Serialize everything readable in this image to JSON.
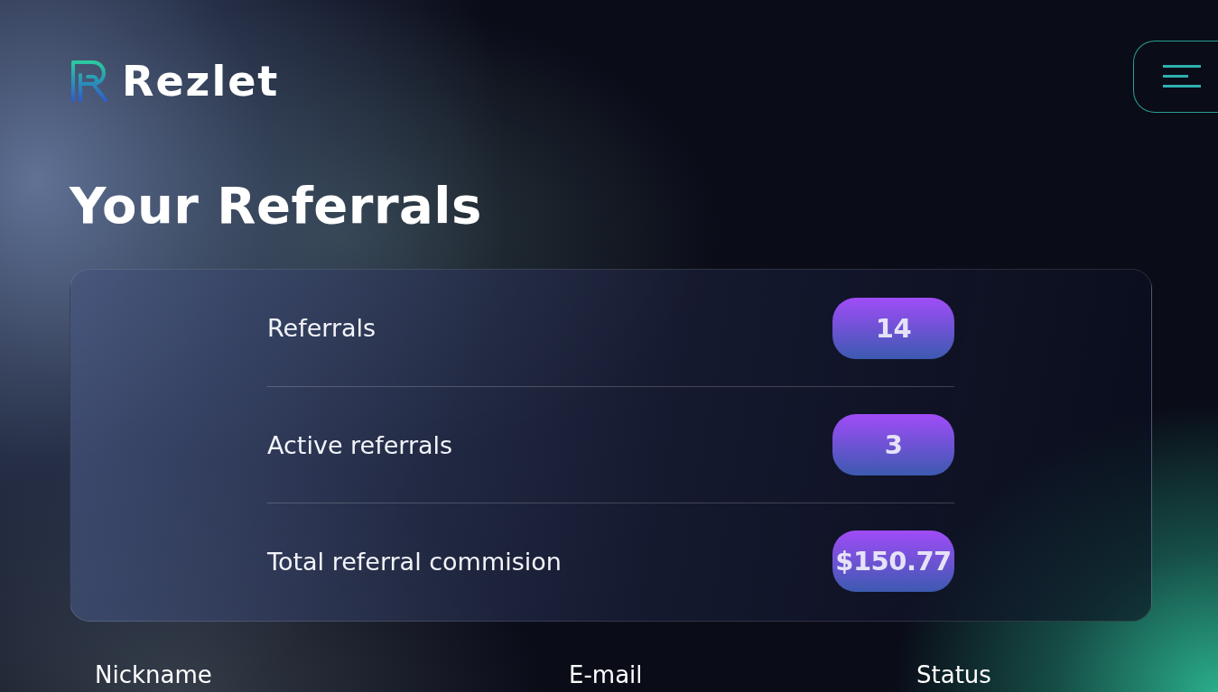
{
  "brand": {
    "name": "Rezlet"
  },
  "heading": "Your Referrals",
  "stats": [
    {
      "label": "Referrals",
      "value": "14"
    },
    {
      "label": "Active referrals",
      "value": "3"
    },
    {
      "label": "Total referral commision",
      "value": "$150.77"
    }
  ],
  "table": {
    "columns": [
      "Nickname",
      "E-mail",
      "Status"
    ]
  }
}
